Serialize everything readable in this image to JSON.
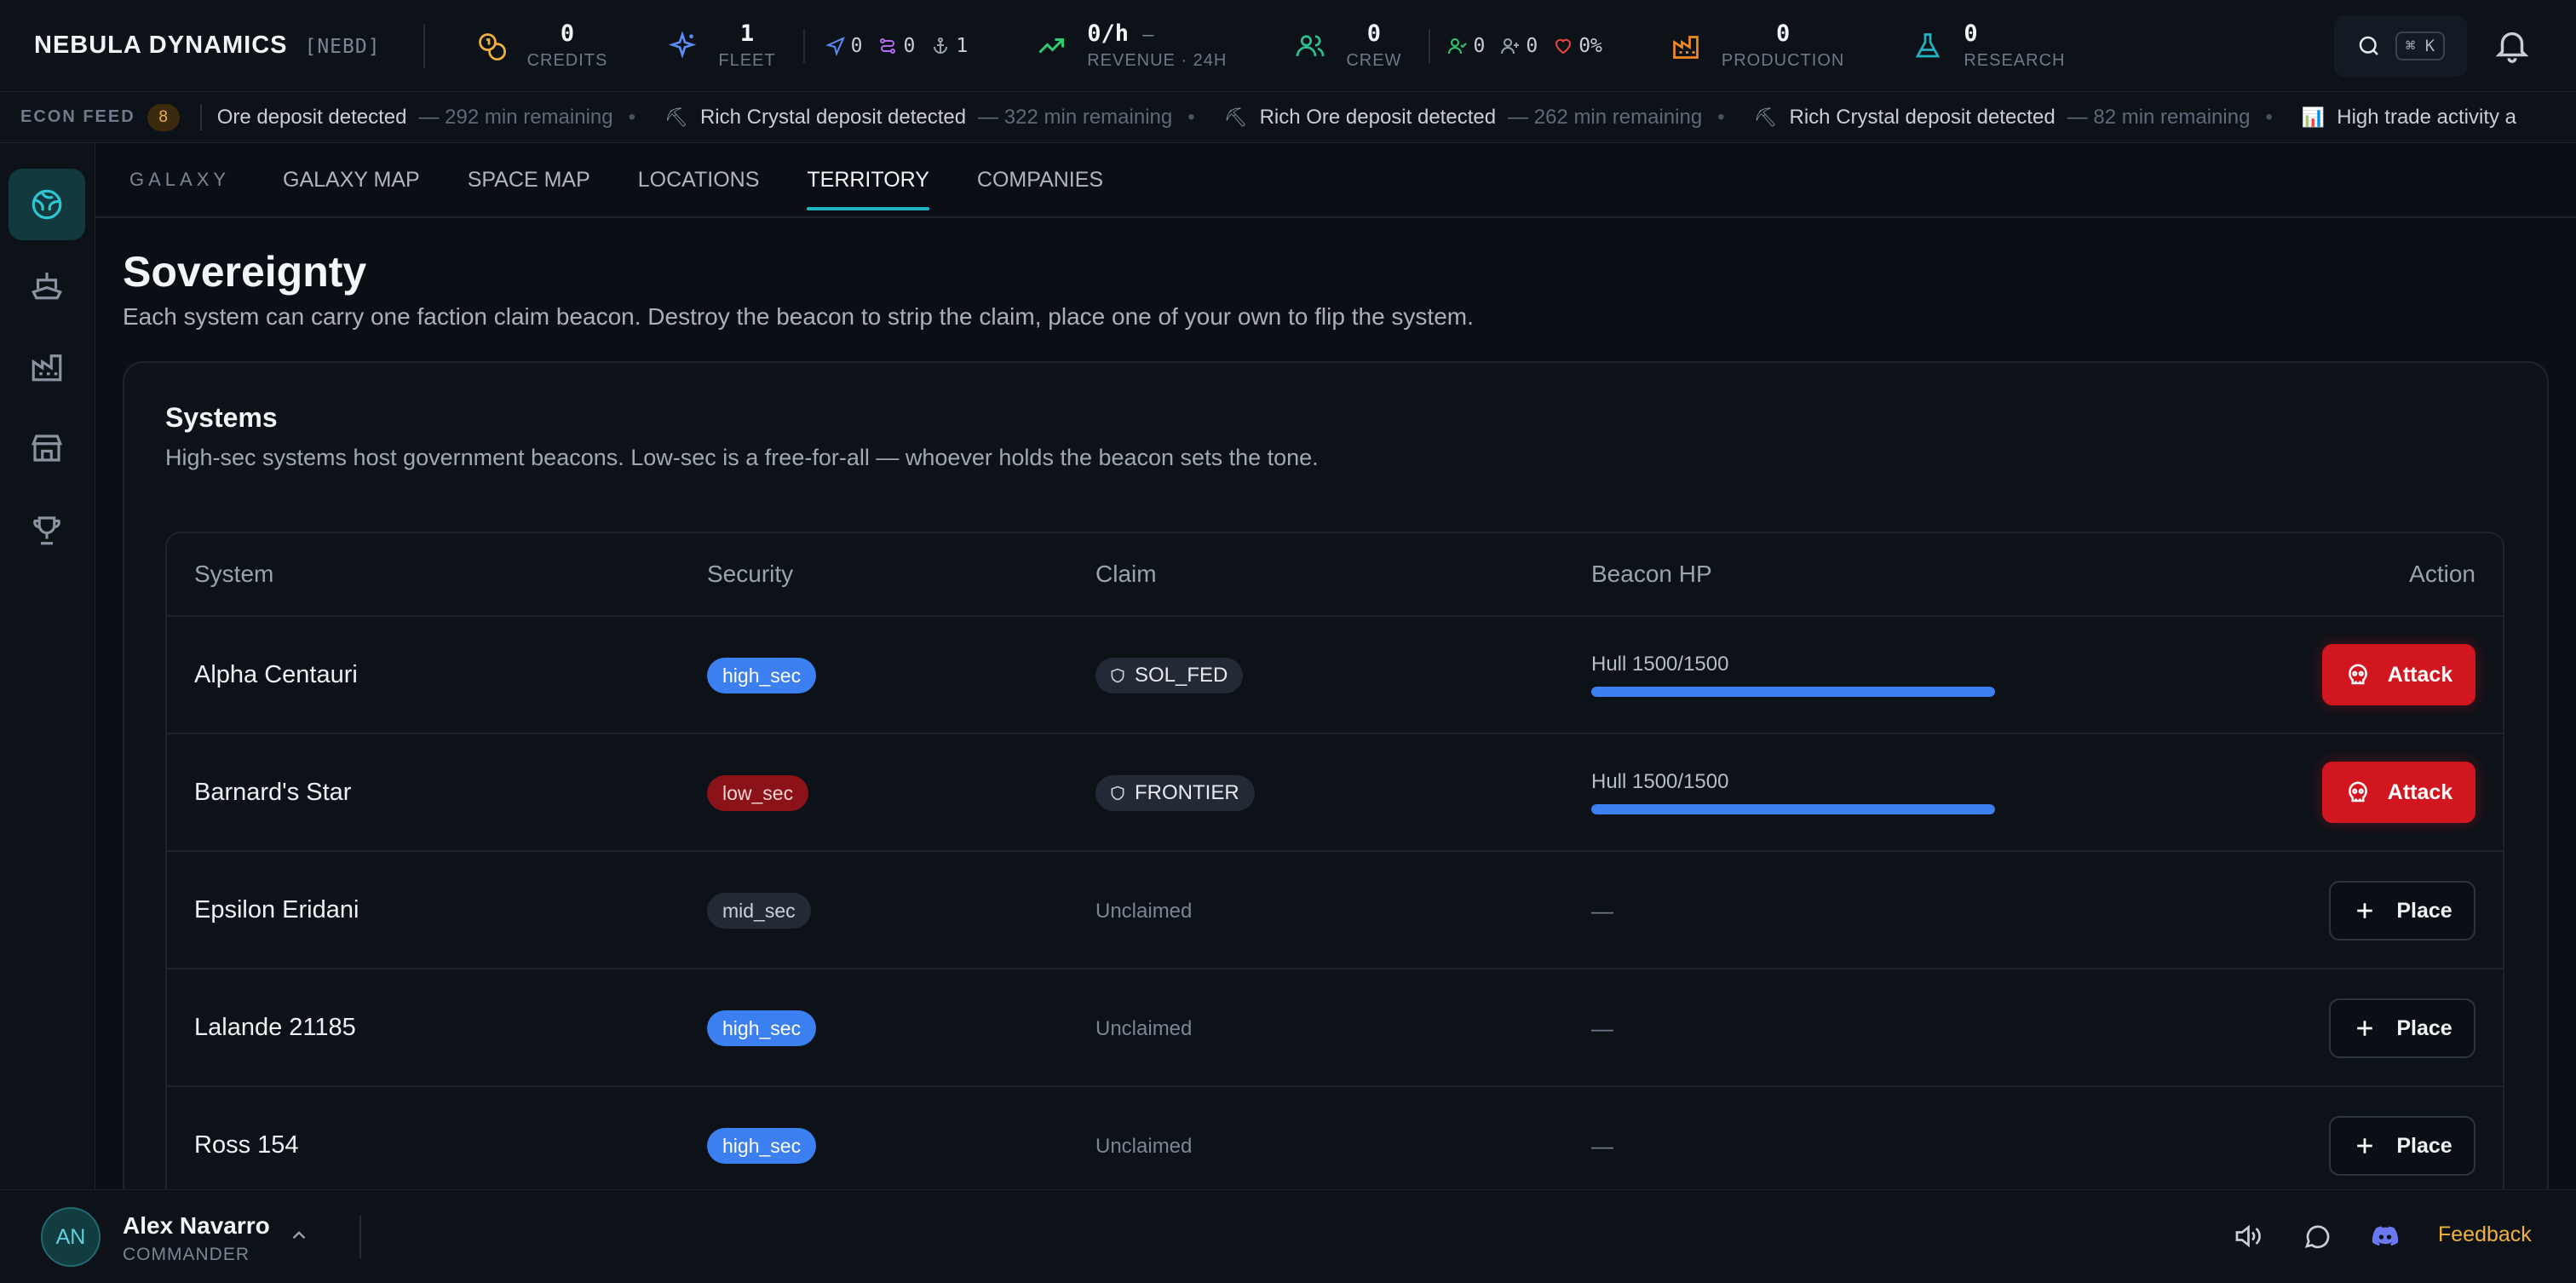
{
  "brand": {
    "name": "NEBULA DYNAMICS",
    "ticker": "[NEBD]"
  },
  "stats": {
    "credits": {
      "value": "0",
      "label": "CREDITS"
    },
    "fleet": {
      "value": "1",
      "label": "FLEET"
    },
    "fleet_mini": [
      "0",
      "0",
      "1"
    ],
    "revenue": {
      "value": "0/h",
      "trend": "—",
      "label": "REVENUE · 24H"
    },
    "crew": {
      "value": "0",
      "label": "CREW"
    },
    "crew_mini": [
      "0",
      "0",
      "0%"
    ],
    "production": {
      "value": "0",
      "label": "PRODUCTION"
    },
    "research": {
      "value": "0",
      "label": "RESEARCH"
    }
  },
  "search": {
    "shortcut": "⌘ K"
  },
  "ticker": {
    "label": "ECON FEED",
    "count": "8",
    "items": [
      {
        "icon": "⛏",
        "text": "Ore deposit detected",
        "remaining": "— 292 min remaining"
      },
      {
        "icon": "⛏",
        "text": "Rich Crystal deposit detected",
        "remaining": "— 322 min remaining"
      },
      {
        "icon": "⛏",
        "text": "Rich Ore deposit detected",
        "remaining": "— 262 min remaining"
      },
      {
        "icon": "⛏",
        "text": "Rich Crystal deposit detected",
        "remaining": "— 82 min remaining"
      },
      {
        "icon": "📊",
        "text": "High trade activity a",
        "remaining": ""
      }
    ]
  },
  "tabs": {
    "section": "GALAXY",
    "items": [
      {
        "label": "GALAXY MAP",
        "active": false
      },
      {
        "label": "SPACE MAP",
        "active": false
      },
      {
        "label": "LOCATIONS",
        "active": false
      },
      {
        "label": "TERRITORY",
        "active": true
      },
      {
        "label": "COMPANIES",
        "active": false
      }
    ]
  },
  "page": {
    "title": "Sovereignty",
    "subtitle": "Each system can carry one faction claim beacon. Destroy the beacon to strip the claim, place one of your own to flip the system."
  },
  "systems_card": {
    "title": "Systems",
    "subtitle": "High-sec systems host government beacons. Low-sec is a free-for-all — whoever holds the beacon sets the tone.",
    "columns": [
      "System",
      "Security",
      "Claim",
      "Beacon HP",
      "Action"
    ],
    "rows": [
      {
        "system": "Alpha Centauri",
        "security": "high_sec",
        "claim": "SOL_FED",
        "hp_text": "Hull 1500/1500",
        "hp_fraction": 1.0,
        "action": "Attack"
      },
      {
        "system": "Barnard's Star",
        "security": "low_sec",
        "claim": "FRONTIER",
        "hp_text": "Hull 1500/1500",
        "hp_fraction": 1.0,
        "action": "Attack"
      },
      {
        "system": "Epsilon Eridani",
        "security": "mid_sec",
        "claim": "Unclaimed",
        "hp_text": "—",
        "action": "Place"
      },
      {
        "system": "Lalande 21185",
        "security": "high_sec",
        "claim": "Unclaimed",
        "hp_text": "—",
        "action": "Place"
      },
      {
        "system": "Ross 154",
        "security": "high_sec",
        "claim": "Unclaimed",
        "hp_text": "—",
        "action": "Place"
      }
    ]
  },
  "user": {
    "initials": "AN",
    "name": "Alex Navarro",
    "role": "COMMANDER"
  },
  "footer": {
    "feedback": "Feedback"
  },
  "colors": {
    "accent": "#22b3c2",
    "attack": "#d1161f",
    "high_sec": "#3b7ff0",
    "low_sec": "#8c1219",
    "feedback": "#f0b23c"
  }
}
